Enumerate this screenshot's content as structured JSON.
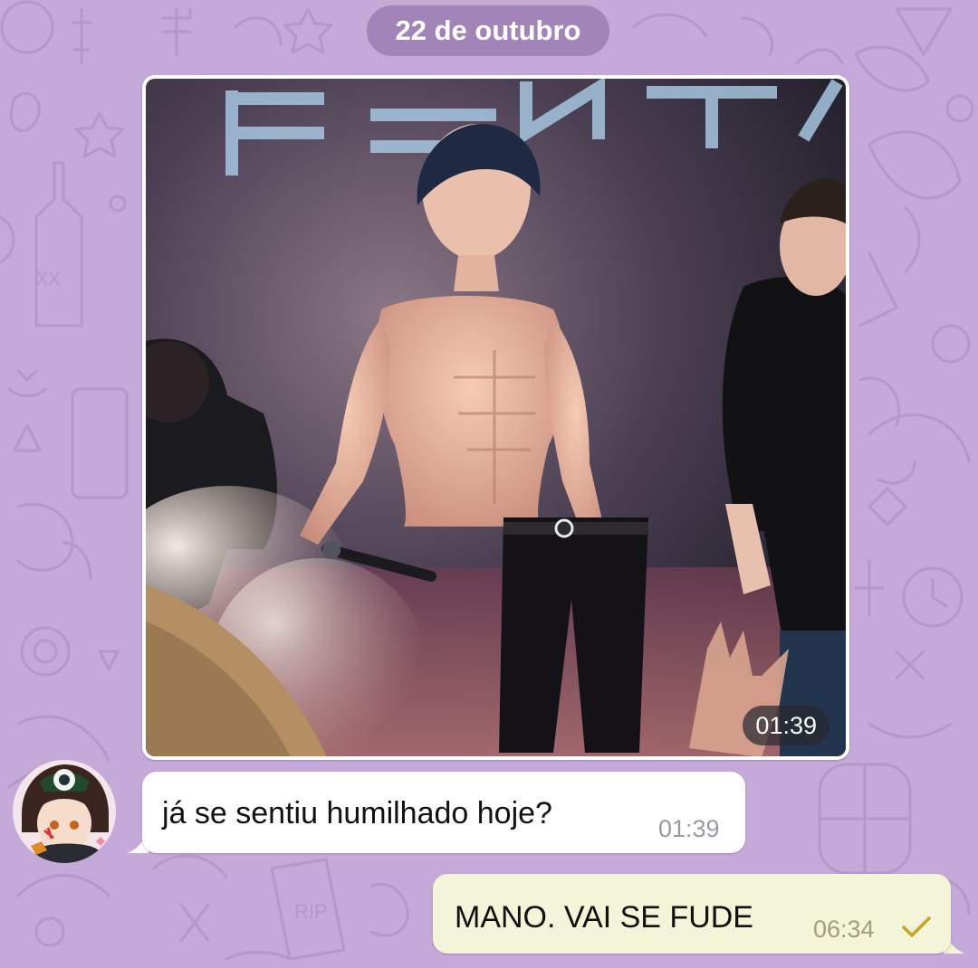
{
  "chat": {
    "date_separator": "22 de outubro",
    "photo_message": {
      "time": "01:39",
      "image_description": "shirtless performer on stage holding a microphone, stage backdrop partially reads PENTA"
    },
    "incoming_message": {
      "text": "já se sentiu humilhado hoje?",
      "time": "01:39"
    },
    "outgoing_message": {
      "text": "MANO. VAI SE FUDE",
      "time": "06:34",
      "status_icon": "check-icon"
    }
  },
  "colors": {
    "wallpaper": "#c4a9d9",
    "incoming_bubble": "#ffffff",
    "outgoing_bubble": "#f4f4d8",
    "check": "#c9a227"
  }
}
